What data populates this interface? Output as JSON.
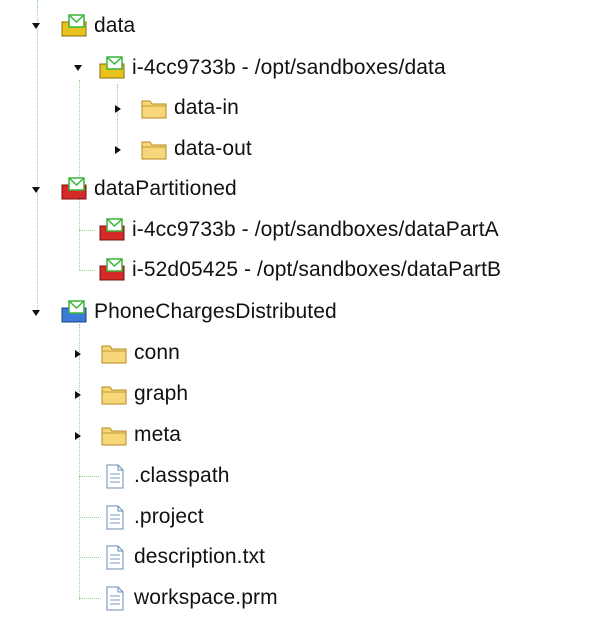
{
  "tree": {
    "nodes": [
      {
        "label": "data",
        "icon": "project-folder-yellow",
        "expanded": true,
        "level": 0
      },
      {
        "label": "i-4cc9733b - /opt/sandboxes/data",
        "icon": "project-folder-yellow",
        "expanded": true,
        "level": 1
      },
      {
        "label": "data-in",
        "icon": "folder",
        "expanded": false,
        "level": 2
      },
      {
        "label": "data-out",
        "icon": "folder",
        "expanded": false,
        "level": 2
      },
      {
        "label": "dataPartitioned",
        "icon": "project-folder-red",
        "expanded": true,
        "level": 0
      },
      {
        "label": "i-4cc9733b - /opt/sandboxes/dataPartA",
        "icon": "project-folder-red",
        "level": 1
      },
      {
        "label": "i-52d05425 - /opt/sandboxes/dataPartB",
        "icon": "project-folder-red",
        "level": 1
      },
      {
        "label": "PhoneChargesDistributed",
        "icon": "project-folder-blue",
        "expanded": true,
        "level": 0
      },
      {
        "label": "conn",
        "icon": "folder",
        "expanded": false,
        "level": 1
      },
      {
        "label": "graph",
        "icon": "folder",
        "expanded": false,
        "level": 1
      },
      {
        "label": "meta",
        "icon": "folder",
        "expanded": false,
        "level": 1
      },
      {
        "label": ".classpath",
        "icon": "file",
        "level": 1
      },
      {
        "label": ".project",
        "icon": "file",
        "level": 1
      },
      {
        "label": "description.txt",
        "icon": "file",
        "level": 1
      },
      {
        "label": "workspace.prm",
        "icon": "file",
        "level": 1
      }
    ]
  },
  "colors": {
    "tree_line": "#8fd48f",
    "folder_fill": "#f6d77a",
    "folder_stroke": "#b58a1e",
    "envelope_green": "#36b536",
    "project_yellow": "#e8c21f",
    "project_red": "#d42a2a",
    "project_blue": "#3a7ad9"
  }
}
